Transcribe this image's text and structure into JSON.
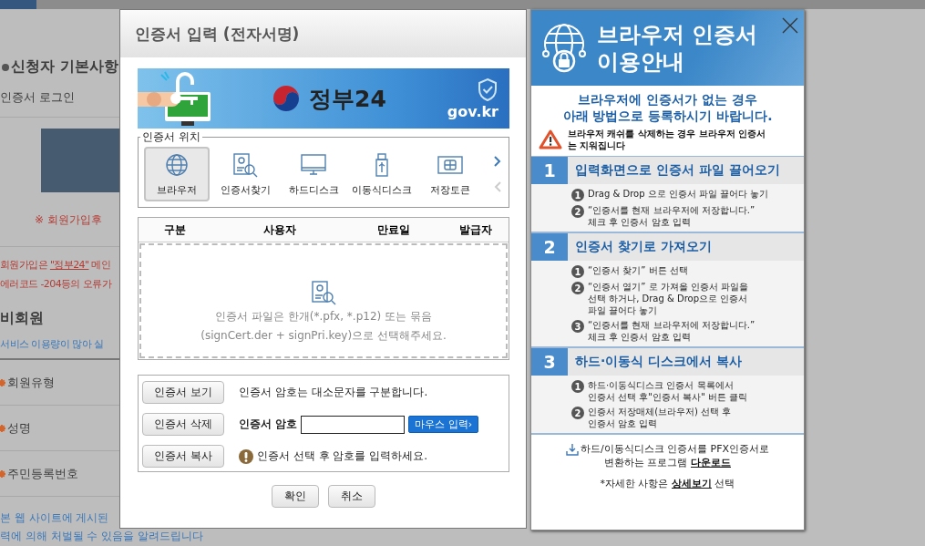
{
  "background": {
    "heading": "신청자 기본사항",
    "login_label": "인증서 로그인",
    "notice": "※ 회원가입후",
    "join_note": {
      "before": "회원가입은 ",
      "link": "\"정부24\"",
      "after": " 메인"
    },
    "error_note": "에러코드 -204등의 오류가",
    "guest_heading": "비회원",
    "guest_note": "서비스 이용량이 많아 실",
    "fields": [
      "회원유형",
      "성명",
      "주민등록번호"
    ],
    "footer_lines": [
      "본 웹 사이트에 게시된",
      "력에 의해 처벌될 수 있음을 알려드립니다"
    ]
  },
  "dialog": {
    "title": "인증서 입력 (전자서명)",
    "banner": {
      "brand": "정부24",
      "domain": "gov.kr"
    },
    "location": {
      "legend": "인증서 위치",
      "items": [
        {
          "label": "브라우저",
          "kind": "globe",
          "selected": true
        },
        {
          "label": "인증서찾기",
          "kind": "find",
          "selected": false
        },
        {
          "label": "하드디스크",
          "kind": "monitor",
          "selected": false
        },
        {
          "label": "이동식디스크",
          "kind": "usb",
          "selected": false
        },
        {
          "label": "저장토큰",
          "kind": "token",
          "selected": false
        }
      ]
    },
    "table": {
      "columns": [
        "구분",
        "사용자",
        "만료일",
        "발급자"
      ],
      "drop_hint": [
        "인증서 파일은 한개(*.pfx, *.p12) 또는 묶음",
        "(signCert.der + signPri.key)으로 선택해주세요."
      ]
    },
    "actions": [
      {
        "button": "인증서 보기",
        "kind": "note",
        "text": "인증서 암호는 대소문자를 구분합니다."
      },
      {
        "button": "인증서 삭제",
        "kind": "password",
        "label": "인증서 암호",
        "extra": "마우스 입력›"
      },
      {
        "button": "인증서 복사",
        "kind": "warning",
        "text": "인증서 선택 후 암호를 입력하세요."
      }
    ],
    "buttons": [
      "확인",
      "취소"
    ]
  },
  "guide": {
    "title_lines": [
      "브라우저 인증서",
      "이용안내"
    ],
    "intro": [
      "브라우저에 인증서가 없는 경우",
      "아래 방법으로 등록하시기 바랍니다."
    ],
    "warning": "브라우저 캐쉬를 삭제하는 경우 브라우저 인증서는 지워집니다",
    "sections": [
      {
        "number": "1",
        "title": "입력화면으로 인증서 파일 끌어오기",
        "steps": [
          {
            "marker": "1",
            "text": "Drag & Drop 으로 인증서 파일 끌어다 놓기"
          },
          {
            "marker": "2",
            "text": "“인증서를 현재 브라우저에 저장합니다.”\n체크 후 인증서 암호 입력"
          }
        ]
      },
      {
        "number": "2",
        "title": "인증서 찾기로 가져오기",
        "steps": [
          {
            "marker": "1",
            "text": "“인증서 찾기” 버튼 선택"
          },
          {
            "marker": "2",
            "text": "“인증서 열기” 로 가져올 인증서 파일을\n선택 하거나, Drag & Drop으로 인증서\n파일 끌어다 놓기"
          },
          {
            "marker": "3",
            "text": "“인증서를 현재 브라우저에 저장합니다.”\n체크 후 인증서 암호 입력"
          }
        ]
      },
      {
        "number": "3",
        "title": "하드·이동식 디스크에서 복사",
        "steps": [
          {
            "marker": "1",
            "text": "하드·이동식디스크 인증서 목록에서\n인증서 선택 후\"인증서 복사\" 버튼 클릭"
          },
          {
            "marker": "2",
            "text": "인증서 저장매체(브라우저) 선택 후\n인증서 암호 입력"
          }
        ]
      }
    ],
    "download": {
      "text": "하드/이동식디스크 인증서를 PFX인증서로",
      "text2": "변환하는 프로그램 ",
      "link": "다운로드"
    },
    "detail": {
      "before": "*자세한 사항은 ",
      "link": "상세보기",
      "after": " 선택"
    }
  }
}
